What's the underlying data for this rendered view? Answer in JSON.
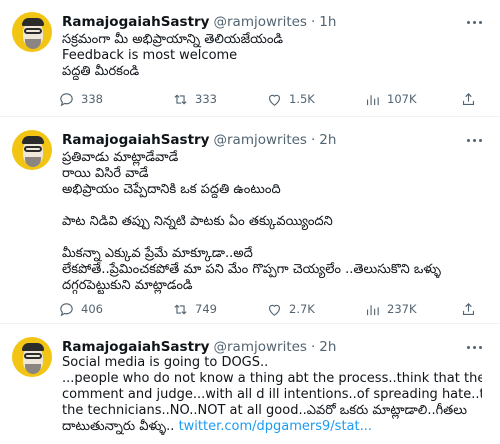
{
  "tweets": [
    {
      "name": "RamajogaiahSastry",
      "handle": "@ramjowrites",
      "dot": "·",
      "time": "1h",
      "lines": [
        "సక్రమంగా మీ అభిప్రాయాన్ని తెలియజేయండి",
        "Feedback is most welcome",
        "పద్ధతి మీరకండి"
      ],
      "replies": "338",
      "retweets": "333",
      "likes": "1.5K",
      "views": "107K"
    },
    {
      "name": "RamajogaiahSastry",
      "handle": "@ramjowrites",
      "dot": "·",
      "time": "2h",
      "lines": [
        "ప్రతివాడు మాట్లాడేవాడే",
        "రాయి విసిరే వాడే",
        "అభిప్రాయం చెప్పేదానికి ఒక పద్ధతి ఉంటుంది",
        "",
        "పాట నిడివి తప్పు నిన్నటి పాటకు ఏం తక్కువయ్యిందని",
        "",
        "మీకన్నా ఎక్కువ ప్రేమే మాక్కూడా..అదే",
        "లేకపోతే..ప్రేమించకపోతే మా పని మేం గొప్పగా చెయ్యలేం ..తెలుసుకొని ఒళ్ళు",
        "దగ్గరపెట్టుకుని మాట్లాడండి"
      ],
      "replies": "406",
      "retweets": "749",
      "likes": "2.7K",
      "views": "237K"
    },
    {
      "name": "RamajogaiahSastry",
      "handle": "@ramjowrites",
      "dot": "·",
      "time": "2h",
      "lines": [
        "Social media is going to DOGS..",
        "...people who do not know a thing abt the process..think that they can",
        "comment and judge...with all d ill intentions..of spreading hate..targeting",
        "the technicians..NO..NOT at all good..ఎవరో ఒకరు మాట్లాడాలి..గీతలు"
      ],
      "last_line_prefix": "దాటుతున్నారు వీళ్ళు..",
      "link": "twitter.com/dpgamers9/stat..."
    }
  ],
  "icons": {
    "reply": "reply-icon",
    "retweet": "retweet-icon",
    "like": "like-icon",
    "views": "views-icon",
    "share": "share-icon",
    "more": "more-icon"
  },
  "colors": {
    "link": "#1d9bf0",
    "secondary_text": "#536471",
    "avatar_bg": "#f2c515"
  }
}
